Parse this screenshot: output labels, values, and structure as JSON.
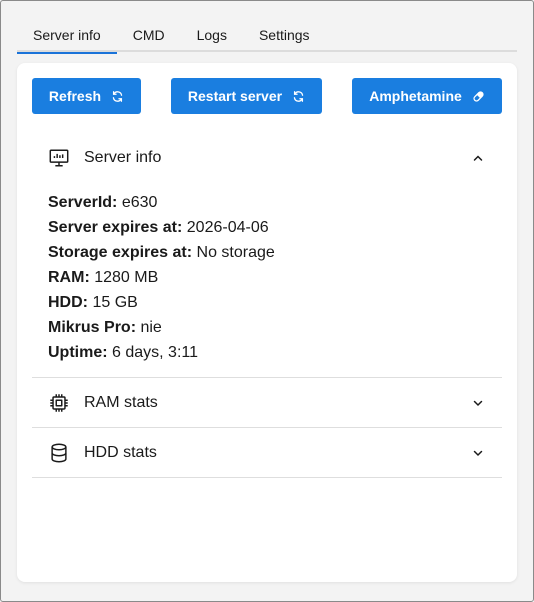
{
  "tabs": [
    "Server info",
    "CMD",
    "Logs",
    "Settings"
  ],
  "active_tab": 0,
  "buttons": {
    "refresh": "Refresh",
    "restart": "Restart server",
    "amphetamine": "Amphetamine"
  },
  "sections": {
    "server_info": "Server info",
    "ram_stats": "RAM stats",
    "hdd_stats": "HDD stats"
  },
  "server_info": [
    {
      "label": "ServerId:",
      "value": "e630"
    },
    {
      "label": "Server expires at:",
      "value": "2026-04-06"
    },
    {
      "label": "Storage expires at:",
      "value": "No storage"
    },
    {
      "label": "RAM:",
      "value": "1280 MB"
    },
    {
      "label": "HDD:",
      "value": "15 GB"
    },
    {
      "label": "Mikrus Pro:",
      "value": "nie"
    },
    {
      "label": "Uptime:",
      "value": "6 days, 3:11"
    }
  ],
  "colors": {
    "accent": "#1a7ee0",
    "tab_underline": "#1a73d9"
  }
}
